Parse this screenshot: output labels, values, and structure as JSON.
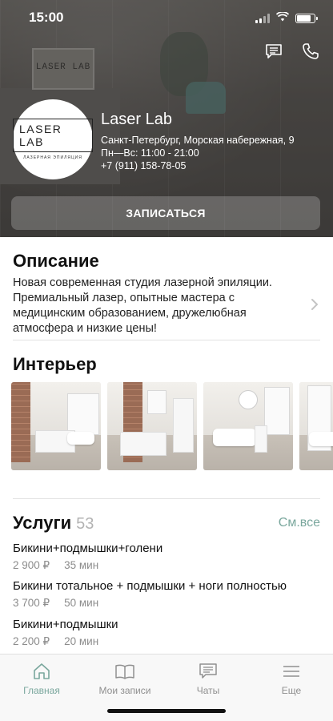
{
  "status_bar": {
    "time": "15:00"
  },
  "hero": {
    "board_text": "LASER LAB",
    "logo_main": "LASER LAB",
    "logo_sub": "ЛАЗЕРНАЯ ЭПИЛЯЦИЯ"
  },
  "salon": {
    "name": "Laser Lab",
    "address": "Санкт-Петербург, Морская набережная, 9",
    "hours": "Пн—Вс: 11:00 - 21:00",
    "phone": "+7 (911) 158-78-05",
    "book_label": "ЗАПИСАТЬСЯ"
  },
  "description": {
    "title": "Описание",
    "text": "Новая современная студия лазерной эпиляции. Премиальный лазер, опытные мастера с медицинским образованием, дружелюбная атмосфера и низкие цены!"
  },
  "interior": {
    "title": "Интерьер"
  },
  "services": {
    "title": "Услуги",
    "count": "53",
    "see_all": "См.все",
    "items": [
      {
        "name": "Бикини+подмышки+голени",
        "price": "2 900 ₽",
        "duration": "35 мин"
      },
      {
        "name": "Бикини тотальное + подмышки + ноги полностью",
        "price": "3 700 ₽",
        "duration": "50 мин"
      },
      {
        "name": "Бикини+подмышки",
        "price": "2 200 ₽",
        "duration": "20 мин"
      }
    ]
  },
  "tabbar": {
    "tabs": [
      {
        "label": "Главная",
        "icon": "home-icon",
        "active": true
      },
      {
        "label": "Мои записи",
        "icon": "book-icon",
        "active": false
      },
      {
        "label": "Чаты",
        "icon": "chat-icon",
        "active": false
      },
      {
        "label": "Еще",
        "icon": "menu-icon",
        "active": false
      }
    ]
  },
  "colors": {
    "accent": "#7aa79d",
    "inactive": "#8f8f8f"
  }
}
